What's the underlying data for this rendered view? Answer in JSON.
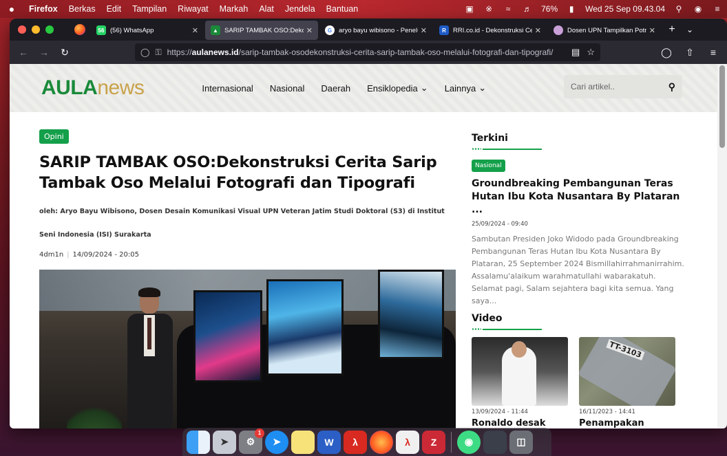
{
  "menubar": {
    "apple": "",
    "app": "Firefox",
    "items": [
      "Berkas",
      "Edit",
      "Tampilan",
      "Riwayat",
      "Markah",
      "Alat",
      "Jendela",
      "Bantuan"
    ],
    "battery": "76%",
    "datetime": "Wed 25 Sep  09.43.04"
  },
  "tabs": [
    {
      "title": "(56) WhatsApp",
      "favicon": "whatsapp-icon",
      "badge": "56",
      "active": false
    },
    {
      "title": "SARIP TAMBAK OSO:Dekonstruksi",
      "favicon": "aula-icon",
      "active": true
    },
    {
      "title": "aryo bayu wibisono - Penelusuran",
      "favicon": "google-icon",
      "active": false
    },
    {
      "title": "RRI.co.id - Dekonstruksi Cerita",
      "favicon": "rri-icon",
      "active": false
    },
    {
      "title": "Dosen UPN Tampilkan Potret",
      "favicon": "upn-icon",
      "active": false
    }
  ],
  "urlbar": {
    "scheme": "https://",
    "host": "aulanews.id",
    "path": "/sarip-tambak-osodekonstruksi-cerita-sarip-tambak-oso-melalui-fotografi-dan-tipografi/"
  },
  "site": {
    "logo_aula": "AULA",
    "logo_news": "news",
    "nav": [
      {
        "label": "Internasional",
        "dropdown": false
      },
      {
        "label": "Nasional",
        "dropdown": false
      },
      {
        "label": "Daerah",
        "dropdown": false
      },
      {
        "label": "Ensiklopedia",
        "dropdown": true
      },
      {
        "label": "Lainnya",
        "dropdown": true
      }
    ],
    "search_placeholder": "Cari artikel.."
  },
  "article": {
    "category": "Opini",
    "title": "SARIP TAMBAK OSO:Dekonstruksi Cerita Sarip Tambak Oso Melalui Fotografi dan Tipografi",
    "byline": "oleh: Aryo Bayu Wibisono, Dosen Desain Komunikasi Visual UPN Veteran Jatim Studi Doktoral (S3) di Institut Seni Indonesia (ISI) Surakarta",
    "author": "4dm1n",
    "date": "14/09/2024 - 20:05"
  },
  "sidebar": {
    "terkini_title": "Terkini",
    "terkini": {
      "category": "Nasional",
      "title": "Groundbreaking Pembangunan Teras Hutan Ibu Kota Nusantara By Plataran ...",
      "date": "25/09/2024 - 09:40",
      "excerpt": "Sambutan Presiden Joko Widodo pada Groundbreaking Pembangunan Teras Hutan Ibu Kota Nusantara By Plataran, 25 September 2024 Bismillahirrahmanirrahim. Assalamu'alaikum warahmatullahi wabarakatuh. Selamat pagi, Salam sejahtera bagi kita semua. Yang saya..."
    },
    "video_title": "Video",
    "videos": [
      {
        "date": "13/09/2024 - 11:44",
        "title": "Ronaldo desak Manchester",
        "thumb_label": ""
      },
      {
        "date": "16/11/2023 - 14:41",
        "title": "Penampakan Detik-Detik",
        "thumb_label": "TT-3103"
      }
    ]
  },
  "dock": {
    "items": [
      "finder-icon",
      "launchpad-icon",
      "system-settings-icon",
      "safari-icon",
      "notes-icon",
      "word-icon",
      "acrobat-icon",
      "firefox-icon",
      "acrobat-reader-icon",
      "zotero-icon",
      "android-file-transfer-icon",
      "preview-icon",
      "trash-icon"
    ],
    "settings_badge": "1"
  },
  "colors": {
    "brand_green": "#14a04a",
    "logo_gold": "#c9a24a"
  }
}
